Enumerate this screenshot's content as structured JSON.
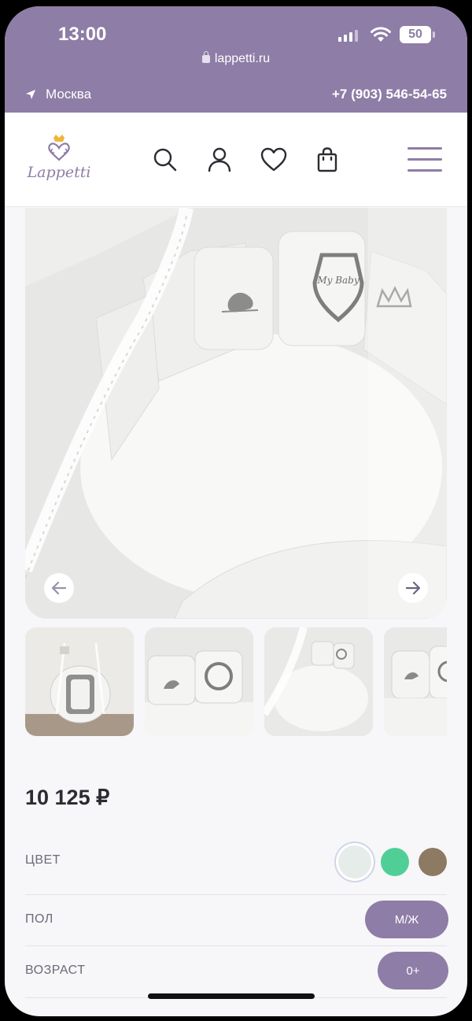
{
  "status_bar": {
    "time": "13:00",
    "battery": "50"
  },
  "browser": {
    "url": "lappetti.ru"
  },
  "topbar": {
    "city": "Москва",
    "phone": "+7 (903) 546-54-65"
  },
  "logo": {
    "text": "Lappetti"
  },
  "colors": {
    "brand": "#8e7da6",
    "background": "#f7f6f9",
    "text": "#2b2b33"
  },
  "gallery": {
    "main_image_alt": "",
    "embroidery_text": "My Baby",
    "thumbnails": [
      "",
      "",
      "",
      ""
    ]
  },
  "product": {
    "price": "10 125 ₽",
    "options": {
      "color_label": "ЦВЕТ",
      "color_swatches": [
        "#e6ecea",
        "#4fcf96",
        "#8c7a62"
      ],
      "gender_label": "ПОЛ",
      "gender_value": "М/Ж",
      "age_label": "ВОЗРАСТ",
      "age_value": "0+"
    }
  }
}
